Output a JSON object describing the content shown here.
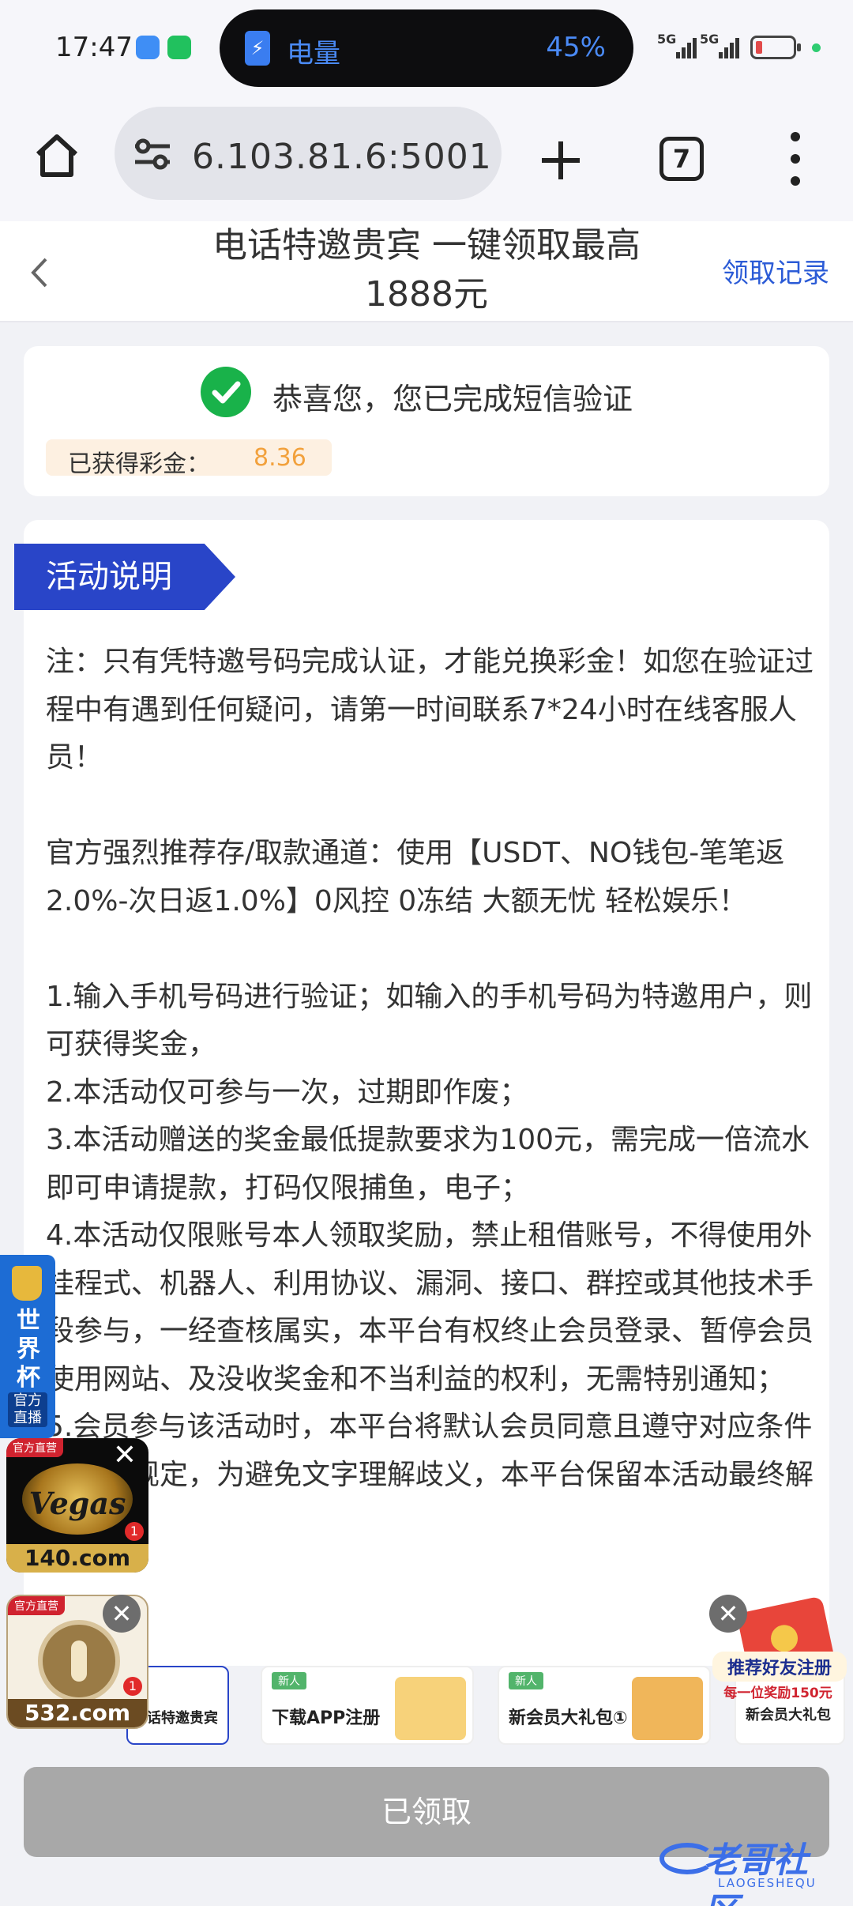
{
  "status_bar": {
    "time": "17:47",
    "pill_label": "电量",
    "pill_percent": "45%",
    "signal_1": "5G",
    "signal_2": "5G",
    "battery_color": "#e24a4a"
  },
  "browser": {
    "url": "6.103.81.6:5001",
    "tab_count": "7",
    "icons": [
      "home-icon",
      "site-settings-icon",
      "plus-icon",
      "tabs-icon",
      "more-vert-icon"
    ]
  },
  "header": {
    "title": "电话特邀贵宾 一键领取最高1888元",
    "history_link": "领取记录"
  },
  "success": {
    "message": "恭喜您，您已完成短信验证",
    "bonus_label": "已获得彩金：",
    "bonus_value": "8.36",
    "check_color": "#19b24a"
  },
  "activity": {
    "tag": "活动说明",
    "note": "注：只有凭特邀号码完成认证，才能兑换彩金！如您在验证过程中有遇到任何疑问，请第一时间联系7*24小时在线客服人员！",
    "recommend": "官方强烈推荐存/取款通道：使用【USDT、NO钱包-笔笔返2.0%-次日返1.0%】0风控 0冻结 大额无忧 轻松娱乐！",
    "rules": [
      "1.输入手机号码进行验证；如输入的手机号码为特邀用户，则可获得奖金，",
      "2.本活动仅可参与一次，过期即作废；",
      "3.本活动赠送的奖金最低提款要求为100元，需完成一倍流水即可申请提款，打码仅限捕鱼，电子；",
      "4.本活动仅限账号本人领取奖励，禁止租借账号，不得使用外挂程式、机器人、利用协议、漏洞、接口、群控或其他技术手段参与，一经查核属实，本平台有权终止会员登录、暂停会员使用网站、及没收奖金和不当利益的权利，无需特别通知；",
      "5.会员参与该活动时，本平台将默认会员同意且遵守对应条件等相关规定，为避免文字理解歧义，本平台保留本活动最终解释权。"
    ]
  },
  "promos": [
    {
      "tag": "",
      "title": "电话特邀贵宾"
    },
    {
      "tag": "新人",
      "title": "下载APP注册"
    },
    {
      "tag": "新人",
      "title": "新会员大礼包①"
    },
    {
      "tag": "",
      "title": "新会员大礼包"
    }
  ],
  "ads": {
    "worldcup_text": "世界杯",
    "worldcup_live": "官方直播",
    "vegas_badge": "官方直营",
    "vegas_logo": "Vegas",
    "vegas_domain": "140.com",
    "vegas_count": "1",
    "ad532_badge": "官方直营",
    "ad532_domain": "532.com",
    "ad532_count": "1",
    "referral_title": "推荐好友注册",
    "referral_sub": "每一位奖励150元"
  },
  "claim_button": "已领取",
  "watermark": {
    "text": "老哥社区",
    "sub": "LAOGESHEQU"
  }
}
